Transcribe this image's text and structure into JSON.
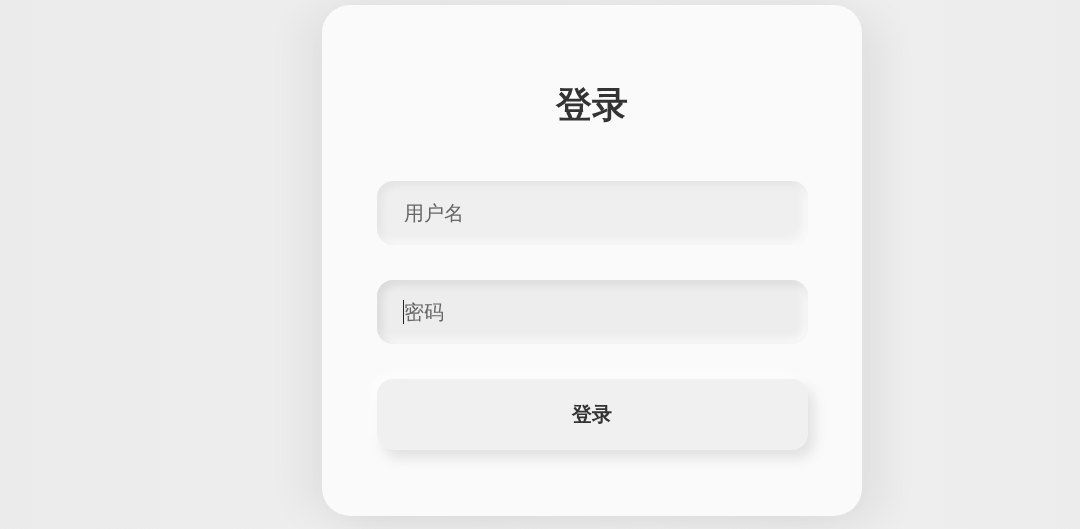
{
  "title": "登录",
  "fields": [
    {
      "placeholder": "用户名",
      "focused": false
    },
    {
      "placeholder": "密码",
      "focused": true
    }
  ],
  "button": {
    "label": "登录"
  }
}
